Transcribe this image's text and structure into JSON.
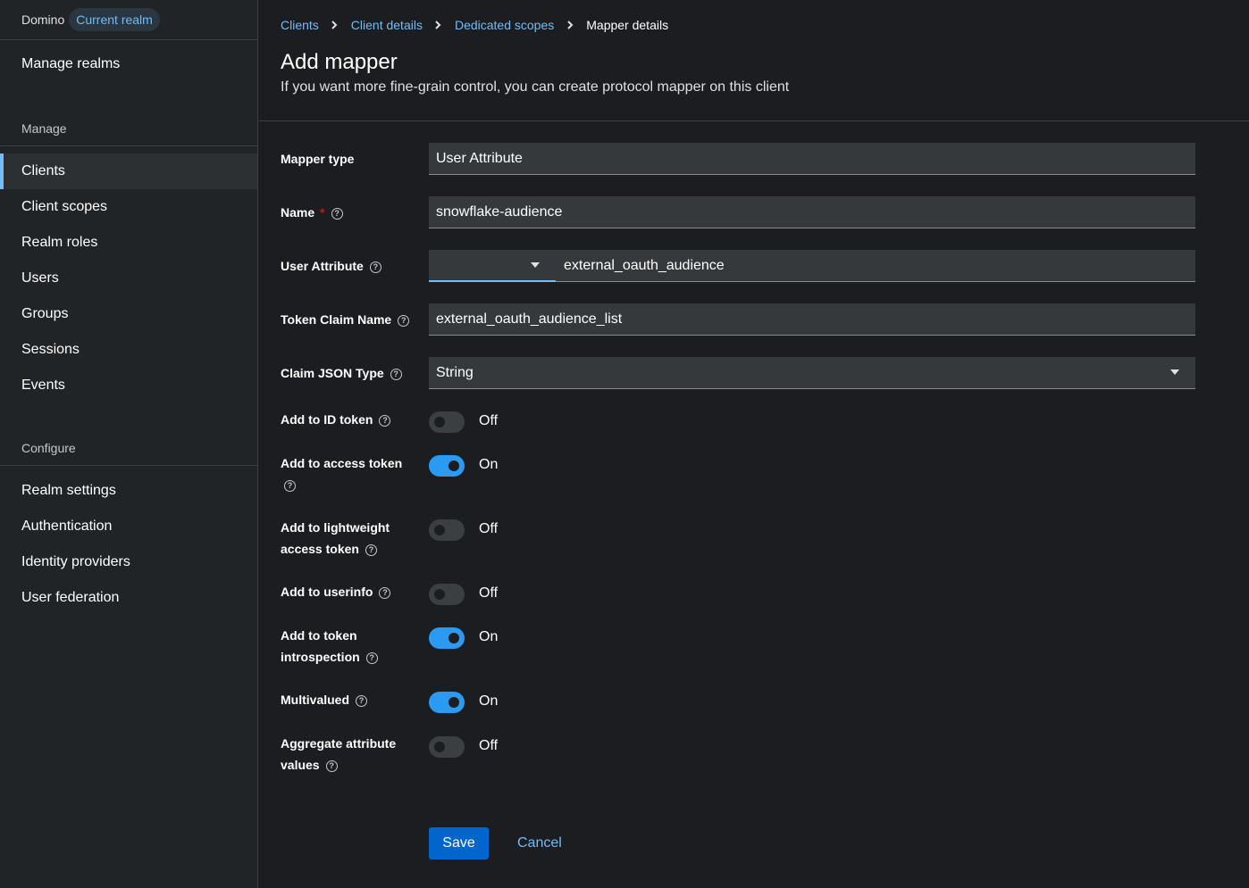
{
  "sidebar": {
    "realm_name": "Domino",
    "realm_badge": "Current realm",
    "manage_realms": "Manage realms",
    "manage_title": "Manage",
    "manage_items": [
      "Clients",
      "Client scopes",
      "Realm roles",
      "Users",
      "Groups",
      "Sessions",
      "Events"
    ],
    "active_item": "Clients",
    "configure_title": "Configure",
    "configure_items": [
      "Realm settings",
      "Authentication",
      "Identity providers",
      "User federation"
    ]
  },
  "breadcrumb": {
    "items": [
      "Clients",
      "Client details",
      "Dedicated scopes"
    ],
    "current": "Mapper details"
  },
  "header": {
    "title": "Add mapper",
    "subtitle": "If you want more fine-grain control, you can create protocol mapper on this client"
  },
  "form": {
    "mapper_type": {
      "label": "Mapper type",
      "value": "User Attribute"
    },
    "name": {
      "label": "Name",
      "required_mark": "*",
      "value": "snowflake-audience"
    },
    "user_attribute": {
      "label": "User Attribute",
      "dropdown_value": "",
      "value": "external_oauth_audience"
    },
    "token_claim_name": {
      "label": "Token Claim Name",
      "value": "external_oauth_audience_list"
    },
    "claim_json_type": {
      "label": "Claim JSON Type",
      "value": "String"
    },
    "toggles": {
      "id_token": {
        "label": "Add to ID token",
        "state": "Off",
        "on": false
      },
      "access_token": {
        "label": "Add to access token",
        "state": "On",
        "on": true
      },
      "lightweight": {
        "label_line1": "Add to lightweight",
        "label_line2": "access token",
        "state": "Off",
        "on": false
      },
      "userinfo": {
        "label": "Add to userinfo",
        "state": "Off",
        "on": false
      },
      "introspection": {
        "label_line1": "Add to token",
        "label_line2": "introspection",
        "state": "On",
        "on": true
      },
      "multivalued": {
        "label": "Multivalued",
        "state": "On",
        "on": true
      },
      "aggregate": {
        "label_line1": "Aggregate attribute",
        "label_line2": "values",
        "state": "Off",
        "on": false
      }
    }
  },
  "actions": {
    "save": "Save",
    "cancel": "Cancel"
  },
  "colors": {
    "accent": "#73bcf7",
    "primary_button": "#0066cc",
    "toggle_on": "#2b9af3"
  }
}
